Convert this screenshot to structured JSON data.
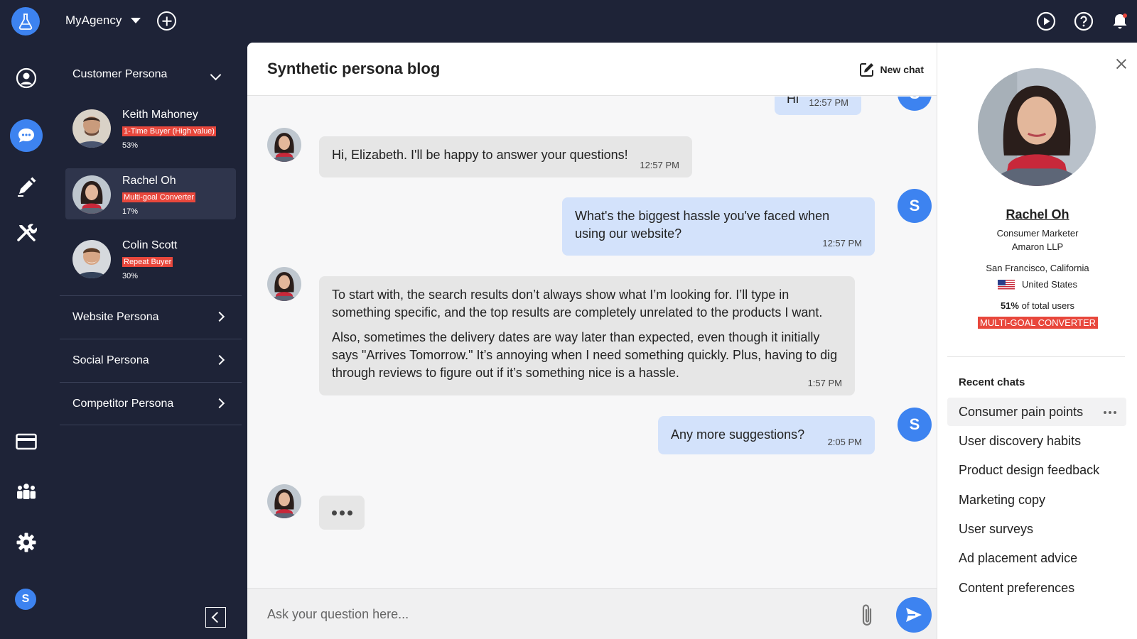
{
  "colors": {
    "app_bg": "#1e2337",
    "accent": "#3d83f0",
    "tag_red": "#e8473c",
    "bot_bubble": "#e6e6e6",
    "user_bubble": "#d3e2fb"
  },
  "topbar": {
    "agency_name": "MyAgency",
    "icons": [
      "flask-logo-icon",
      "chevron-down-icon",
      "add-circle-icon",
      "play-circle-icon",
      "help-circle-icon",
      "bell-icon"
    ]
  },
  "rail": {
    "icons": [
      "user-circle-icon",
      "chat-icon",
      "pencil-icon",
      "tools-icon",
      "credit-card-icon",
      "team-icon",
      "gear-icon"
    ],
    "user_initial": "S"
  },
  "personas": {
    "customer": {
      "title": "Customer Persona",
      "items": [
        {
          "name": "Keith Mahoney",
          "tag": "1-Time Buyer (High value)",
          "percent": "53%"
        },
        {
          "name": "Rachel Oh",
          "tag": "Multi-goal Converter",
          "percent": "17%"
        },
        {
          "name": "Colin Scott",
          "tag": "Repeat Buyer",
          "percent": "30%"
        }
      ]
    },
    "sections": [
      {
        "label": "Website Persona"
      },
      {
        "label": "Social Persona"
      },
      {
        "label": "Competitor Persona"
      }
    ]
  },
  "chat": {
    "title": "Synthetic persona blog",
    "new_chat_label": "New chat",
    "user_initial": "S",
    "messages": [
      {
        "role": "user",
        "paragraphs": [
          "Hi"
        ],
        "time": "12:57 PM"
      },
      {
        "role": "bot",
        "paragraphs": [
          "Hi, Elizabeth. I'll be happy to answer your questions!"
        ],
        "time": "12:57 PM"
      },
      {
        "role": "user",
        "paragraphs": [
          "What's the biggest hassle you've faced when using our website?"
        ],
        "time": "12:57 PM"
      },
      {
        "role": "bot",
        "paragraphs": [
          "To start with, the search results don’t always show what I’m looking for. I’ll type in something specific, and the top results are completely unrelated to the products I want.",
          "Also, sometimes the delivery dates are way later than expected, even though it initially says \"Arrives Tomorrow.\" It’s annoying when I need something quickly. Plus, having to dig through reviews to figure out if it’s something nice is a hassle."
        ],
        "time": "1:57 PM"
      },
      {
        "role": "user",
        "paragraphs": [
          "Any more suggestions?"
        ],
        "time": "2:05 PM"
      }
    ],
    "composer_placeholder": "Ask your question here..."
  },
  "profile": {
    "name": "Rachel Oh",
    "role": "Consumer Marketer",
    "company": "Amaron LLP",
    "city": "San Francisco, California",
    "country": "United States",
    "share_value": "51%",
    "share_text": "of total users",
    "segment": "MULTI-GOAL CONVERTER",
    "recent_title": "Recent chats",
    "recent_chats": [
      {
        "label": "Consumer pain points"
      },
      {
        "label": "User discovery habits"
      },
      {
        "label": "Product design feedback"
      },
      {
        "label": "Marketing copy"
      },
      {
        "label": "User surveys"
      },
      {
        "label": "Ad placement advice"
      },
      {
        "label": "Content preferences"
      }
    ]
  }
}
